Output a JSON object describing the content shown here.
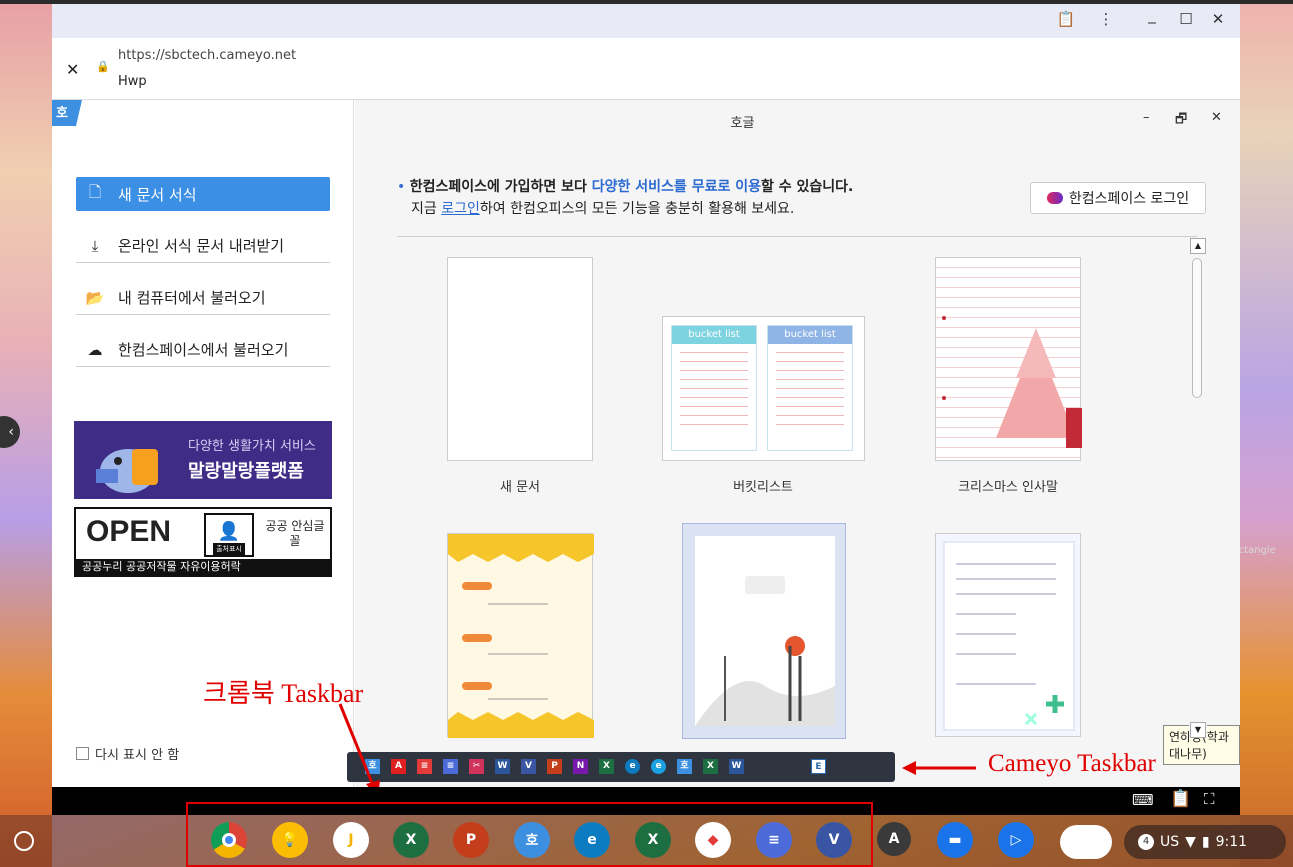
{
  "browser": {
    "url": "https://sbctech.cameyo.net",
    "page_title": "Hwp",
    "close_icon": "close-icon",
    "lock_icon": "lock-icon"
  },
  "window_controls": {
    "clipboard": "📋",
    "menu": "⋮",
    "minimize": "_",
    "maximize": "☐",
    "close": "✕"
  },
  "hwp": {
    "logo": "호",
    "title": "호글",
    "sidebar": [
      {
        "label": "새 문서 서식",
        "icon": "🗋"
      },
      {
        "label": "온라인 서식 문서 내려받기",
        "icon": "⤓"
      },
      {
        "label": "내 컴퓨터에서 불러오기",
        "icon": "📂"
      },
      {
        "label": "한컴스페이스에서 불러오기",
        "icon": "☁"
      }
    ],
    "banner1": {
      "line1": "다양한 생활가치 서비스",
      "line2": "말랑말랑플랫폼"
    },
    "banner2": {
      "open": "OPEN",
      "badge": "출처표시",
      "right": "공공 안심글꼴",
      "bottom": "공공누리  공공저작물 자유이용허락"
    },
    "dont_show": "다시 표시 안 함",
    "notice_line1_a": "한컴스페이스에 가입하면 보다 ",
    "notice_line1_b": "다양한 서비스를 무료로 이용",
    "notice_line1_c": "할 수 있습니다.",
    "notice_line2_a": "지금 ",
    "notice_line2_link": "로그인",
    "notice_line2_b": "하여 한컴오피스의 모든 기능을 충분히 활용해 보세요.",
    "login_button": "한컴스페이스 로그인",
    "templates": [
      {
        "label": "새 문서"
      },
      {
        "label": "버킷리스트"
      },
      {
        "label": "크리스마스 인사말"
      },
      {
        "label": ""
      },
      {
        "label": ""
      },
      {
        "label": ""
      }
    ],
    "bucket_header": "bucket list",
    "tooltip": "연하장(학과 대나무)"
  },
  "cameyo_taskbar": {
    "icons": [
      "호",
      "A",
      "≡",
      "≡",
      "✂",
      "W",
      "V",
      "P",
      "N",
      "X",
      "e",
      "e",
      "호",
      "X",
      "W",
      "E"
    ]
  },
  "annotations": {
    "chromebook_taskbar": "크롬북 Taskbar",
    "cameyo_taskbar": "Cameyo Taskbar",
    "overlay_label": "Rectangle"
  },
  "shelf": {
    "apps": [
      {
        "name": "chrome",
        "glyph": "",
        "color": "#ffffff"
      },
      {
        "name": "keep",
        "glyph": "💡",
        "color": "#fbbc04"
      },
      {
        "name": "jamboard",
        "glyph": "J",
        "color": "#f4b400"
      },
      {
        "name": "excel",
        "glyph": "X",
        "color": "#1d6f42"
      },
      {
        "name": "powerpoint",
        "glyph": "P",
        "color": "#c43e1c"
      },
      {
        "name": "hwp",
        "glyph": "호",
        "color": "#3d8fe0"
      },
      {
        "name": "edge",
        "glyph": "e",
        "color": "#0c7bc0"
      },
      {
        "name": "excel-2",
        "glyph": "X",
        "color": "#1d6f42"
      },
      {
        "name": "sway",
        "glyph": "◆",
        "color": "#e0e0e0"
      },
      {
        "name": "word-form",
        "glyph": "≡",
        "color": "#4d6bd8"
      },
      {
        "name": "visio",
        "glyph": "V",
        "color": "#3955a3"
      },
      {
        "name": "avatar-a",
        "glyph": "A",
        "color": "#3a3a3a"
      },
      {
        "name": "files",
        "glyph": "▬",
        "color": "#1a73e8"
      },
      {
        "name": "play",
        "glyph": "▷",
        "color": "#1a73e8"
      }
    ],
    "status": {
      "notifications": "4",
      "locale": "US",
      "time": "9:11"
    }
  }
}
